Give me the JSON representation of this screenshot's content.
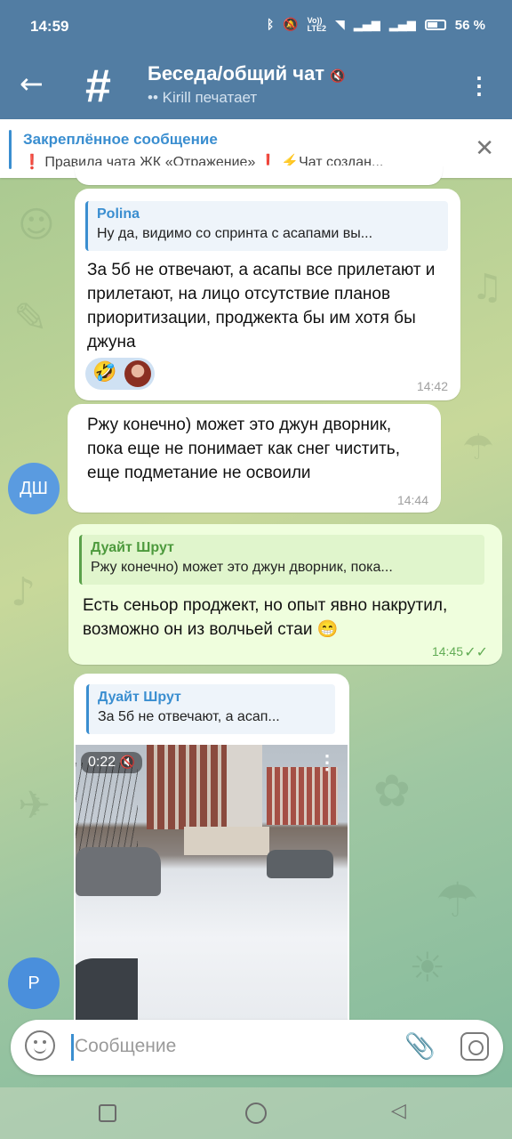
{
  "status_bar": {
    "time": "14:59",
    "battery": "56 %"
  },
  "header": {
    "back_icon": "back-arrow-icon",
    "chat_icon": "hash-icon",
    "title": "Беседа/общий чат",
    "subtitle": "•• Kirill печатает",
    "menu_icon": "more-vert-icon"
  },
  "pinned": {
    "label": "Закреплённое сообщение",
    "text": "❗ Правила чата ЖК «Отражение» ❗ ⚡Чат создан..."
  },
  "messages": [
    {
      "direction": "incoming",
      "reply_name": "Polina",
      "reply_text": "Ну да, видимо со спринта с асапами вы...",
      "text": "За 5б не отвечают, а асапы все прилетают и прилетают, на лицо отсутствие планов приоритизации, проджекта бы им хотя бы джуна",
      "reaction_emoji": "🤣",
      "time": "14:42"
    },
    {
      "direction": "incoming",
      "text": "Ржу конечно) может это джун дворник, пока еще не понимает как снег чистить, еще подметание не освоили",
      "time": "14:44",
      "avatar": "ДШ"
    },
    {
      "direction": "outgoing",
      "reply_name": "Дуайт Шрут",
      "reply_text": "Ржу конечно) может это джун дворник, пока...",
      "text": "Есть сеньор проджект, но опыт явно накрутил, возможно он из волчьей стаи 😁",
      "time": "14:45",
      "status": "read"
    },
    {
      "direction": "incoming",
      "reply_name": "Дуайт Шрут",
      "reply_text": "За 5б не отвечают, а асап...",
      "video_duration": "0:22",
      "avatar": "Р"
    }
  ],
  "composer": {
    "placeholder": "Сообщение",
    "emoji_icon": "smile-icon",
    "attach_icon": "paperclip-icon",
    "camera_icon": "camera-icon"
  },
  "colors": {
    "header_bg": "#527da3",
    "accent": "#3a8ed0",
    "outgoing_bubble": "#effedd",
    "avatar_dsh": "#5a9be0",
    "avatar_r": "#4a8fdc"
  }
}
